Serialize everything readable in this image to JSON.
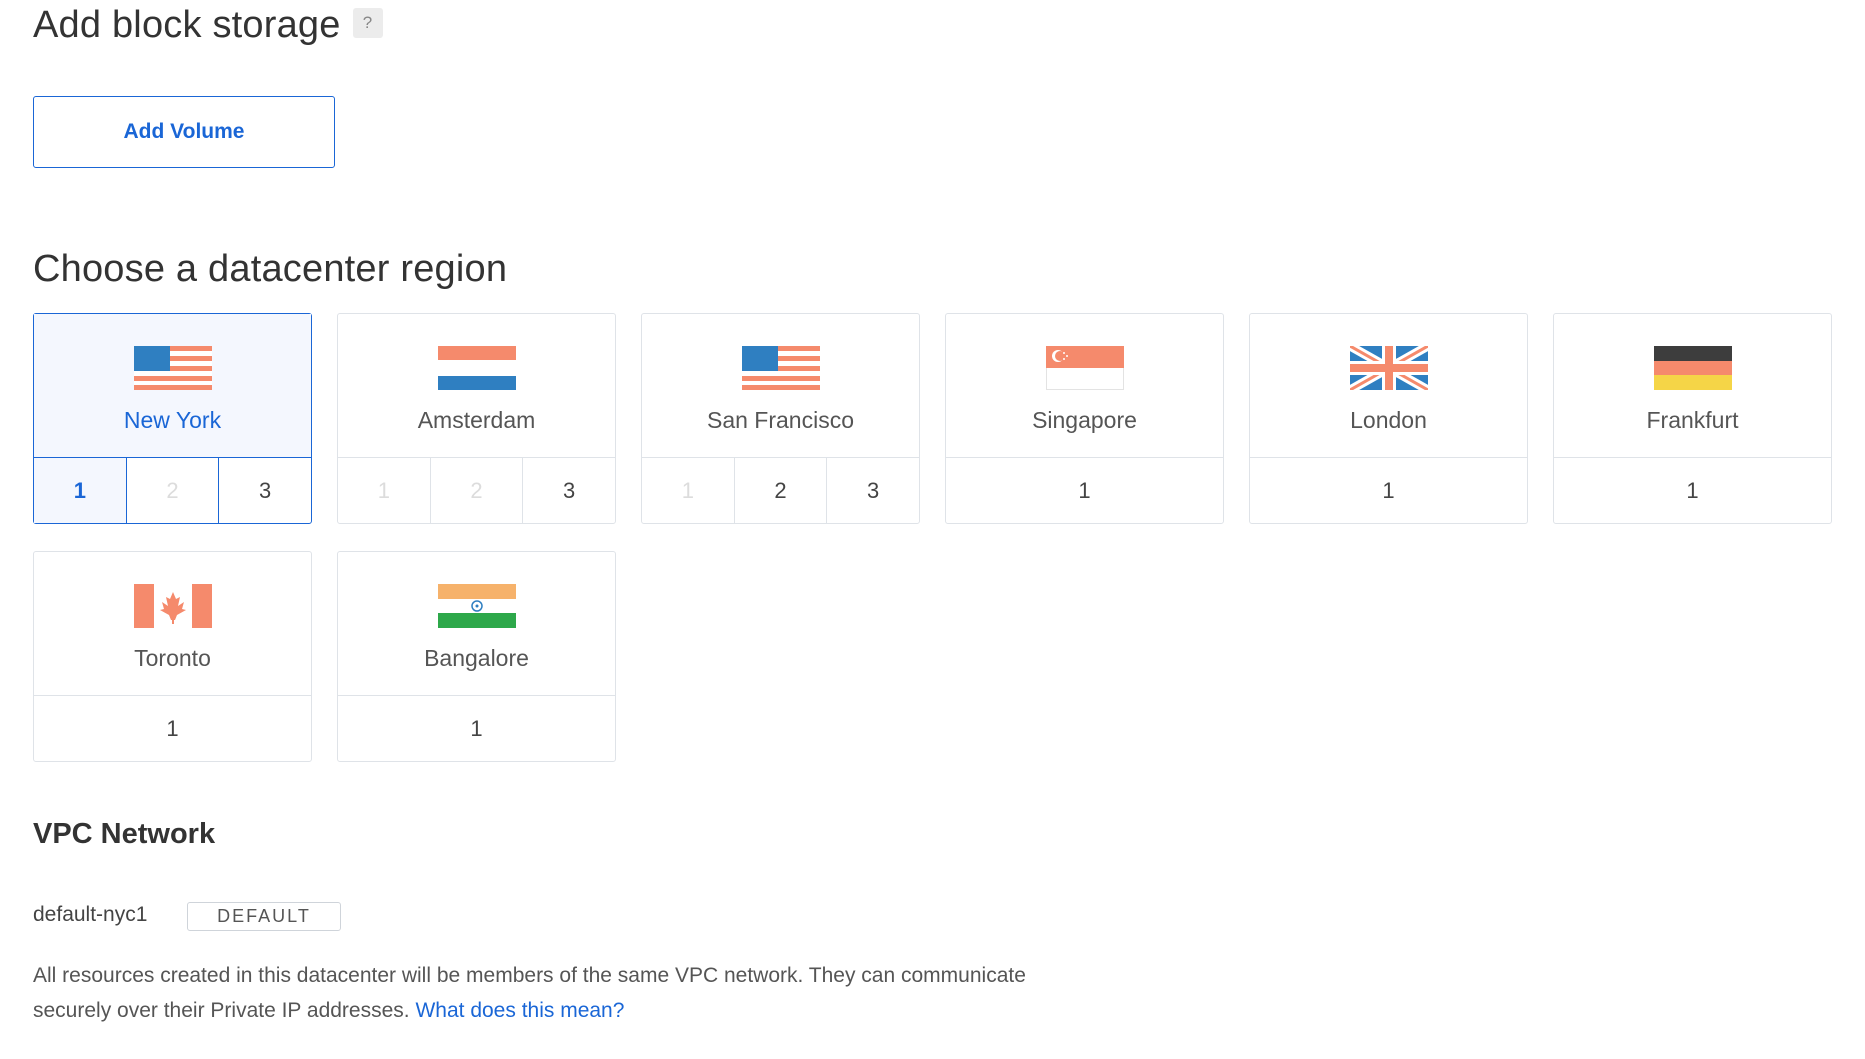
{
  "block_storage": {
    "title": "Add block storage",
    "help": "?",
    "add_button": "Add Volume"
  },
  "region": {
    "title": "Choose a datacenter region",
    "regions": [
      {
        "name": "New York",
        "flag": "us-flag",
        "numbers": [
          "1",
          "2",
          "3"
        ],
        "selected": "1"
      },
      {
        "name": "Amsterdam",
        "flag": "netherlands-flag",
        "numbers": [
          "1",
          "2",
          "3"
        ]
      },
      {
        "name": "San Francisco",
        "flag": "us-flag",
        "numbers": [
          "1",
          "2",
          "3"
        ]
      },
      {
        "name": "Singapore",
        "flag": "singapore-flag",
        "numbers": [
          "1"
        ]
      },
      {
        "name": "London",
        "flag": "uk-flag",
        "numbers": [
          "1"
        ]
      },
      {
        "name": "Frankfurt",
        "flag": "germany-flag",
        "numbers": [
          "1"
        ]
      },
      {
        "name": "Toronto",
        "flag": "canada-flag",
        "numbers": [
          "1"
        ]
      },
      {
        "name": "Bangalore",
        "flag": "india-flag",
        "numbers": [
          "1"
        ]
      }
    ]
  },
  "vpc": {
    "title": "VPC Network",
    "name": "default-nyc1",
    "badge": "DEFAULT",
    "description": "All resources created in this datacenter will be members of the same VPC network. They can communicate securely over their Private IP addresses.",
    "link": "What does this mean?"
  },
  "colors": {
    "accent": "#1a66d6",
    "flag_blue": "#2f7fc1",
    "flag_coral": "#f58a6c"
  }
}
